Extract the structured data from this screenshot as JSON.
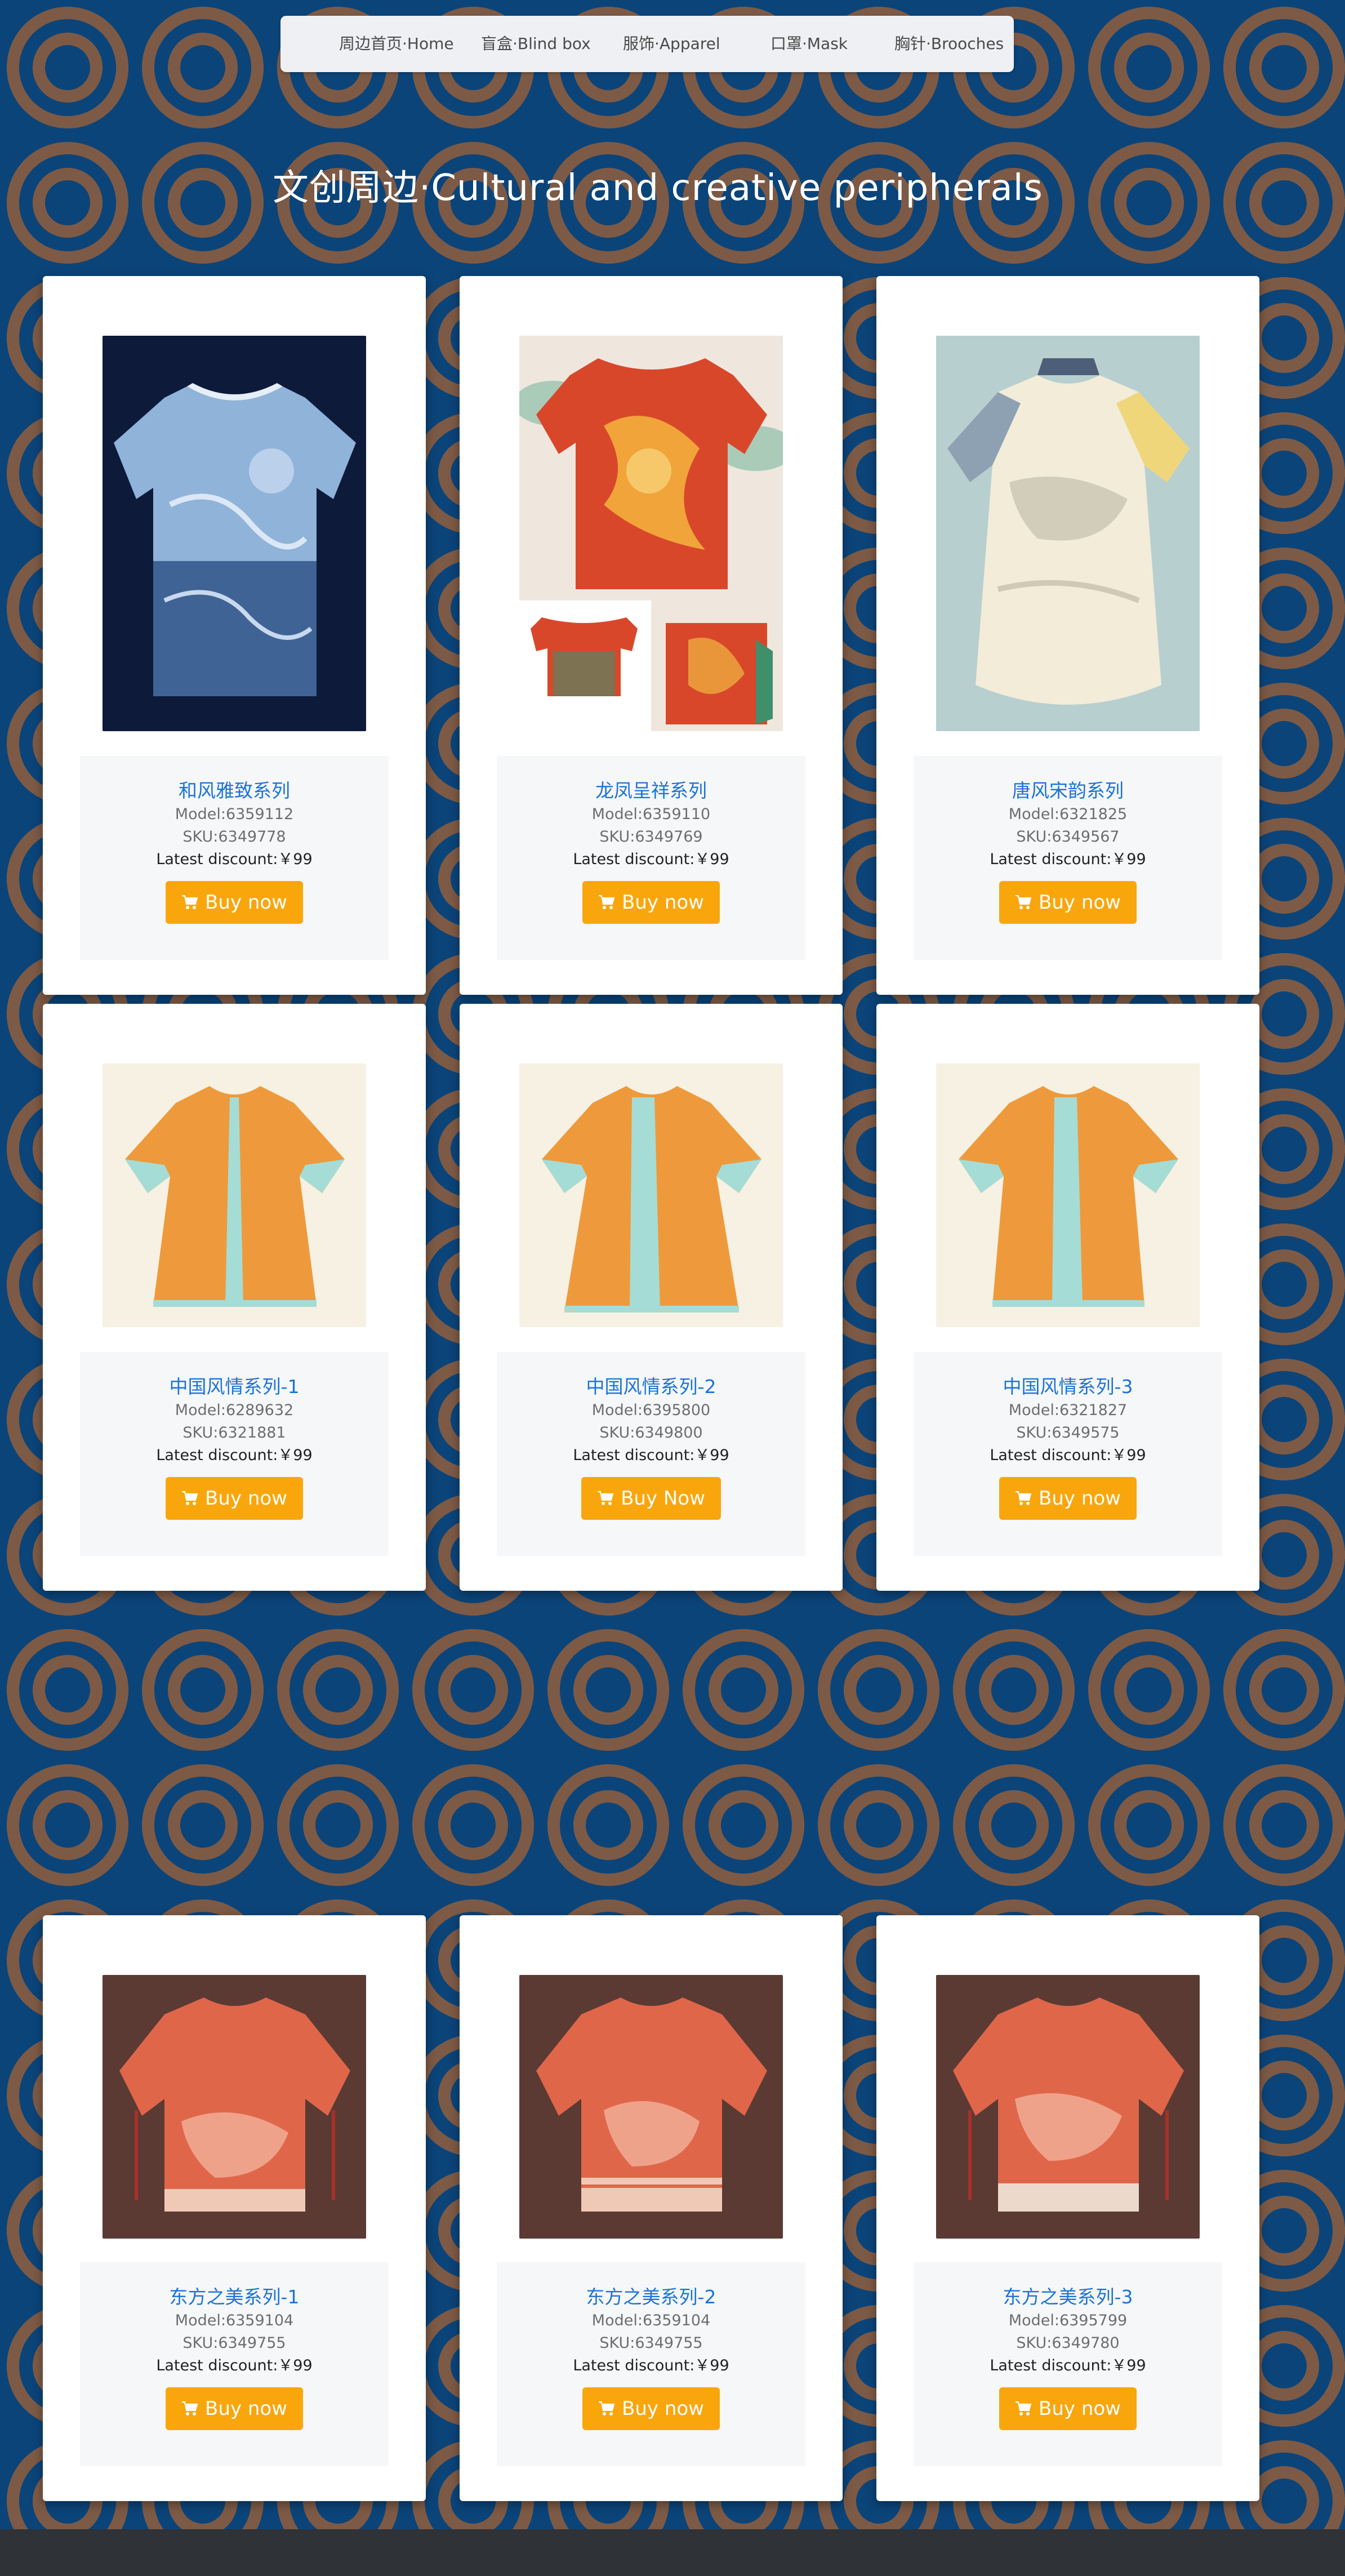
{
  "nav": {
    "items": [
      {
        "label": "周边首页·Home"
      },
      {
        "label": "盲盒·Blind box"
      },
      {
        "label": "服饰·Apparel"
      },
      {
        "label": "口罩·Mask"
      },
      {
        "label": "胸针·Brooches"
      }
    ]
  },
  "page": {
    "title": "文创周边·Cultural and creative peripherals"
  },
  "products": [
    {
      "name": "和风雅致系列",
      "model": "Model:6359112",
      "sku": "SKU:6349778",
      "discount": "Latest discount:￥99",
      "buy_label": "Buy now",
      "image_icon": "blue-tshirt-image"
    },
    {
      "name": "龙凤呈祥系列",
      "model": "Model:6359110",
      "sku": "SKU:6349769",
      "discount": "Latest discount:￥99",
      "buy_label": "Buy now",
      "image_icon": "red-dragon-tshirt-image"
    },
    {
      "name": "唐风宋韵系列",
      "model": "Model:6321825",
      "sku": "SKU:6349567",
      "discount": "Latest discount:￥99",
      "buy_label": "Buy now",
      "image_icon": "pale-robe-image"
    },
    {
      "name": "中国风情系列-1",
      "model": "Model:6289632",
      "sku": "SKU:6321881",
      "discount": "Latest discount:￥99",
      "buy_label": "Buy now",
      "image_icon": "orange-robe-image"
    },
    {
      "name": "中国风情系列-2",
      "model": "Model:6395800",
      "sku": "SKU:6349800",
      "discount": "Latest discount:￥99",
      "buy_label": "Buy Now",
      "image_icon": "orange-robe-image"
    },
    {
      "name": "中国风情系列-3",
      "model": "Model:6321827",
      "sku": "SKU:6349575",
      "discount": "Latest discount:￥99",
      "buy_label": "Buy now",
      "image_icon": "orange-robe-image"
    },
    {
      "name": "东方之美系列-1",
      "model": "Model:6359104",
      "sku": "SKU:6349755",
      "discount": "Latest discount:￥99",
      "buy_label": "Buy now",
      "image_icon": "red-robe-image"
    },
    {
      "name": "东方之美系列-2",
      "model": "Model:6359104",
      "sku": "SKU:6349755",
      "discount": "Latest discount:￥99",
      "buy_label": "Buy now",
      "image_icon": "red-robe-image"
    },
    {
      "name": "东方之美系列-3",
      "model": "Model:6395799",
      "sku": "SKU:6349780",
      "discount": "Latest discount:￥99",
      "buy_label": "Buy now",
      "image_icon": "red-robe-image"
    }
  ],
  "colors": {
    "background": "#0b4479",
    "pattern_rings": "#7d5a45",
    "accent_button": "#f9a60d",
    "title_link": "#1a73d9",
    "footer": "#2f3237"
  }
}
